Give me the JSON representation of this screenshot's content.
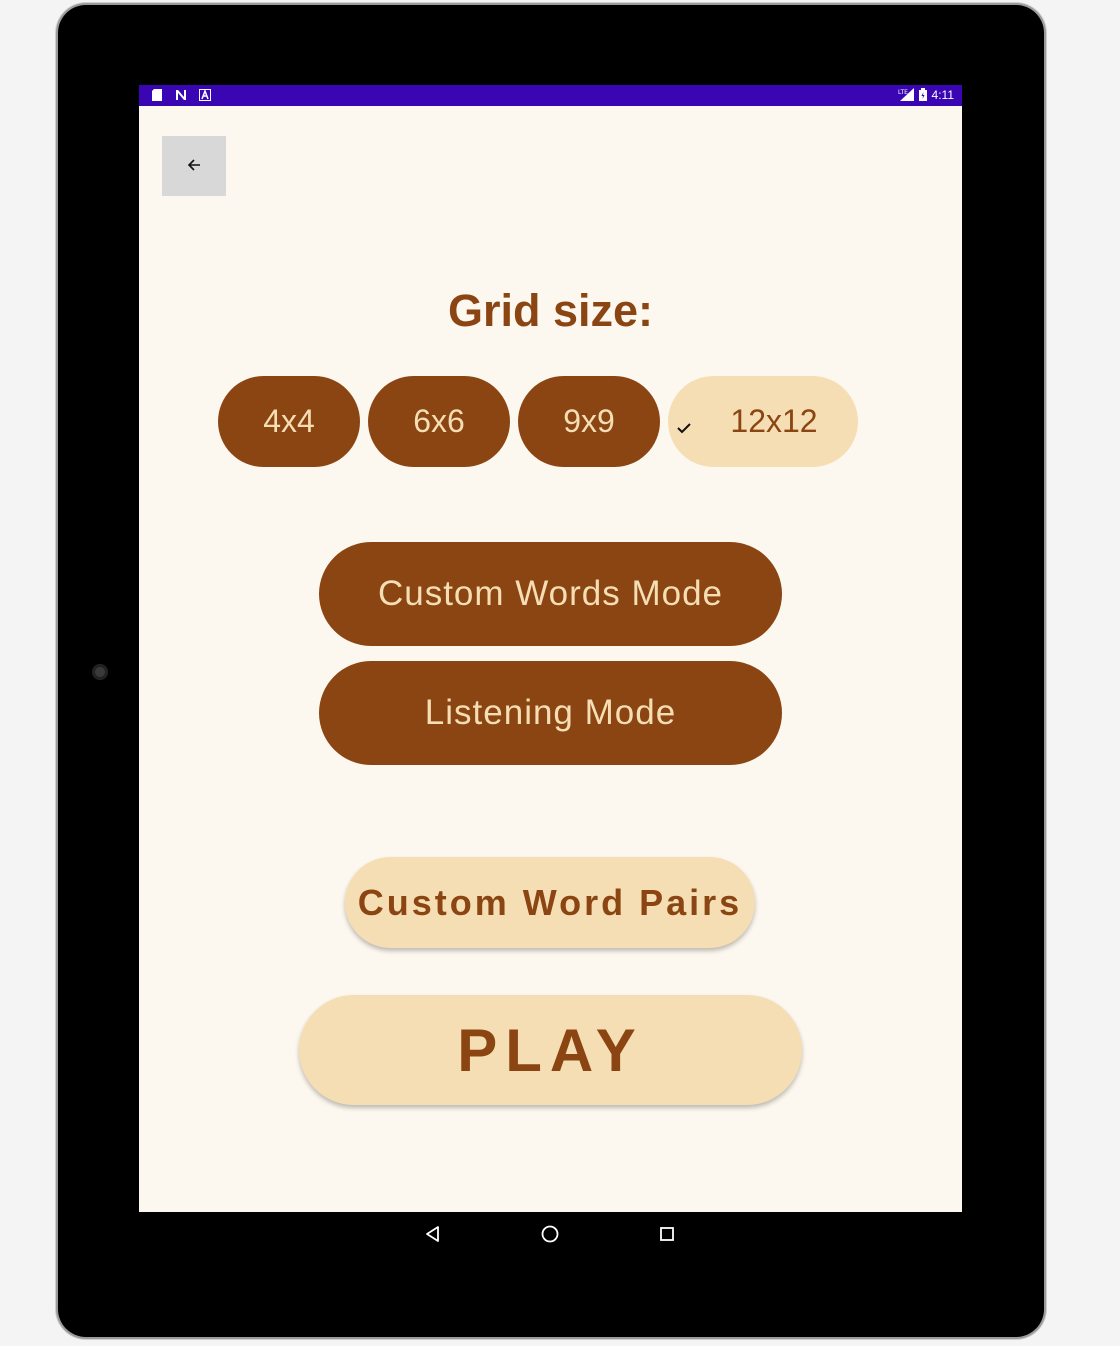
{
  "status_bar": {
    "time": "4:11",
    "left_icons": [
      "sd-card-icon",
      "n-icon",
      "a-icon"
    ],
    "right_icons": [
      "lte-signal-icon",
      "battery-icon"
    ]
  },
  "header": {
    "back_icon": "arrow-left-icon"
  },
  "main": {
    "title": "Grid size:",
    "grid_options": [
      {
        "label": "4x4",
        "selected": false
      },
      {
        "label": "6x6",
        "selected": false
      },
      {
        "label": "9x9",
        "selected": false
      },
      {
        "label": "12x12",
        "selected": true
      }
    ],
    "mode_buttons": [
      {
        "label": "Custom Words Mode"
      },
      {
        "label": "Listening Mode"
      }
    ],
    "custom_pairs_label": "Custom Word Pairs",
    "play_label": "PLAY"
  },
  "nav_bar": {
    "icons": [
      "back-triangle-icon",
      "home-circle-icon",
      "recents-square-icon"
    ]
  },
  "colors": {
    "primary": "#8b4513",
    "accent": "#f5deb3",
    "background": "#fdf8ef",
    "status_bar": "#3a06b4"
  }
}
